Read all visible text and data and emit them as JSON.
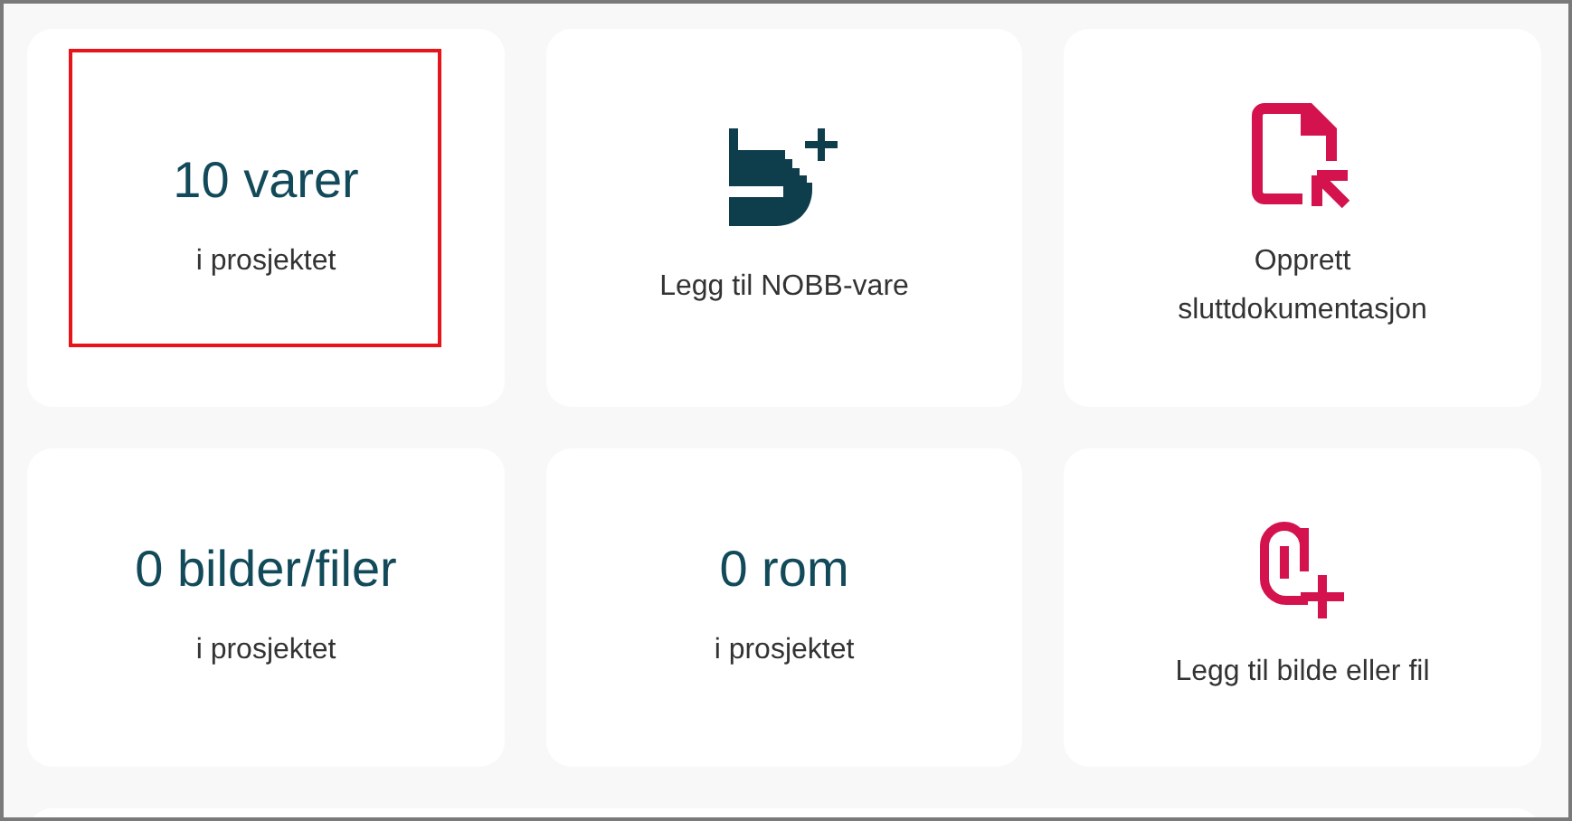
{
  "tiles": [
    {
      "kind": "count",
      "value": "10 varer",
      "caption": "i prosjektet",
      "highlighted": true
    },
    {
      "kind": "add-product",
      "label": "Legg til NOBB-vare",
      "highlighted": false
    },
    {
      "kind": "documentation",
      "label": "Opprett sluttdokumentasjon",
      "highlighted": false
    },
    {
      "kind": "count",
      "value": "0 bilder/filer",
      "caption": "i prosjektet",
      "highlighted": false
    },
    {
      "kind": "count",
      "value": "0 rom",
      "caption": "i prosjektet",
      "highlighted": false
    },
    {
      "kind": "attach",
      "label": "Legg til bilde eller fil",
      "highlighted": false
    }
  ]
}
